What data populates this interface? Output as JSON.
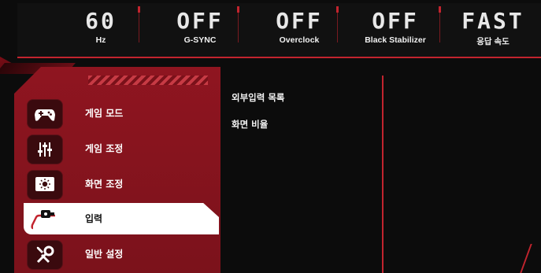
{
  "status": [
    {
      "value": "60",
      "label": "Hz"
    },
    {
      "value": "OFF",
      "label": "G-SYNC"
    },
    {
      "value": "OFF",
      "label": "Overclock"
    },
    {
      "value": "OFF",
      "label": "Black Stabilizer"
    },
    {
      "value": "FAST",
      "label": "응답 속도"
    }
  ],
  "menu": {
    "items": [
      {
        "label": "게임 모드",
        "icon": "gamepad-icon"
      },
      {
        "label": "게임 조정",
        "icon": "sliders-icon"
      },
      {
        "label": "화면 조정",
        "icon": "brightness-icon"
      },
      {
        "label": "입력",
        "icon": "input-source-icon",
        "selected": true
      },
      {
        "label": "일반 설정",
        "icon": "settings-tools-icon"
      }
    ]
  },
  "submenu": {
    "items": [
      "외부입력 목록",
      "화면 비율"
    ]
  },
  "colors": {
    "accent": "#c2242e",
    "panel": "#8f1520",
    "background": "#0c0c0c"
  }
}
